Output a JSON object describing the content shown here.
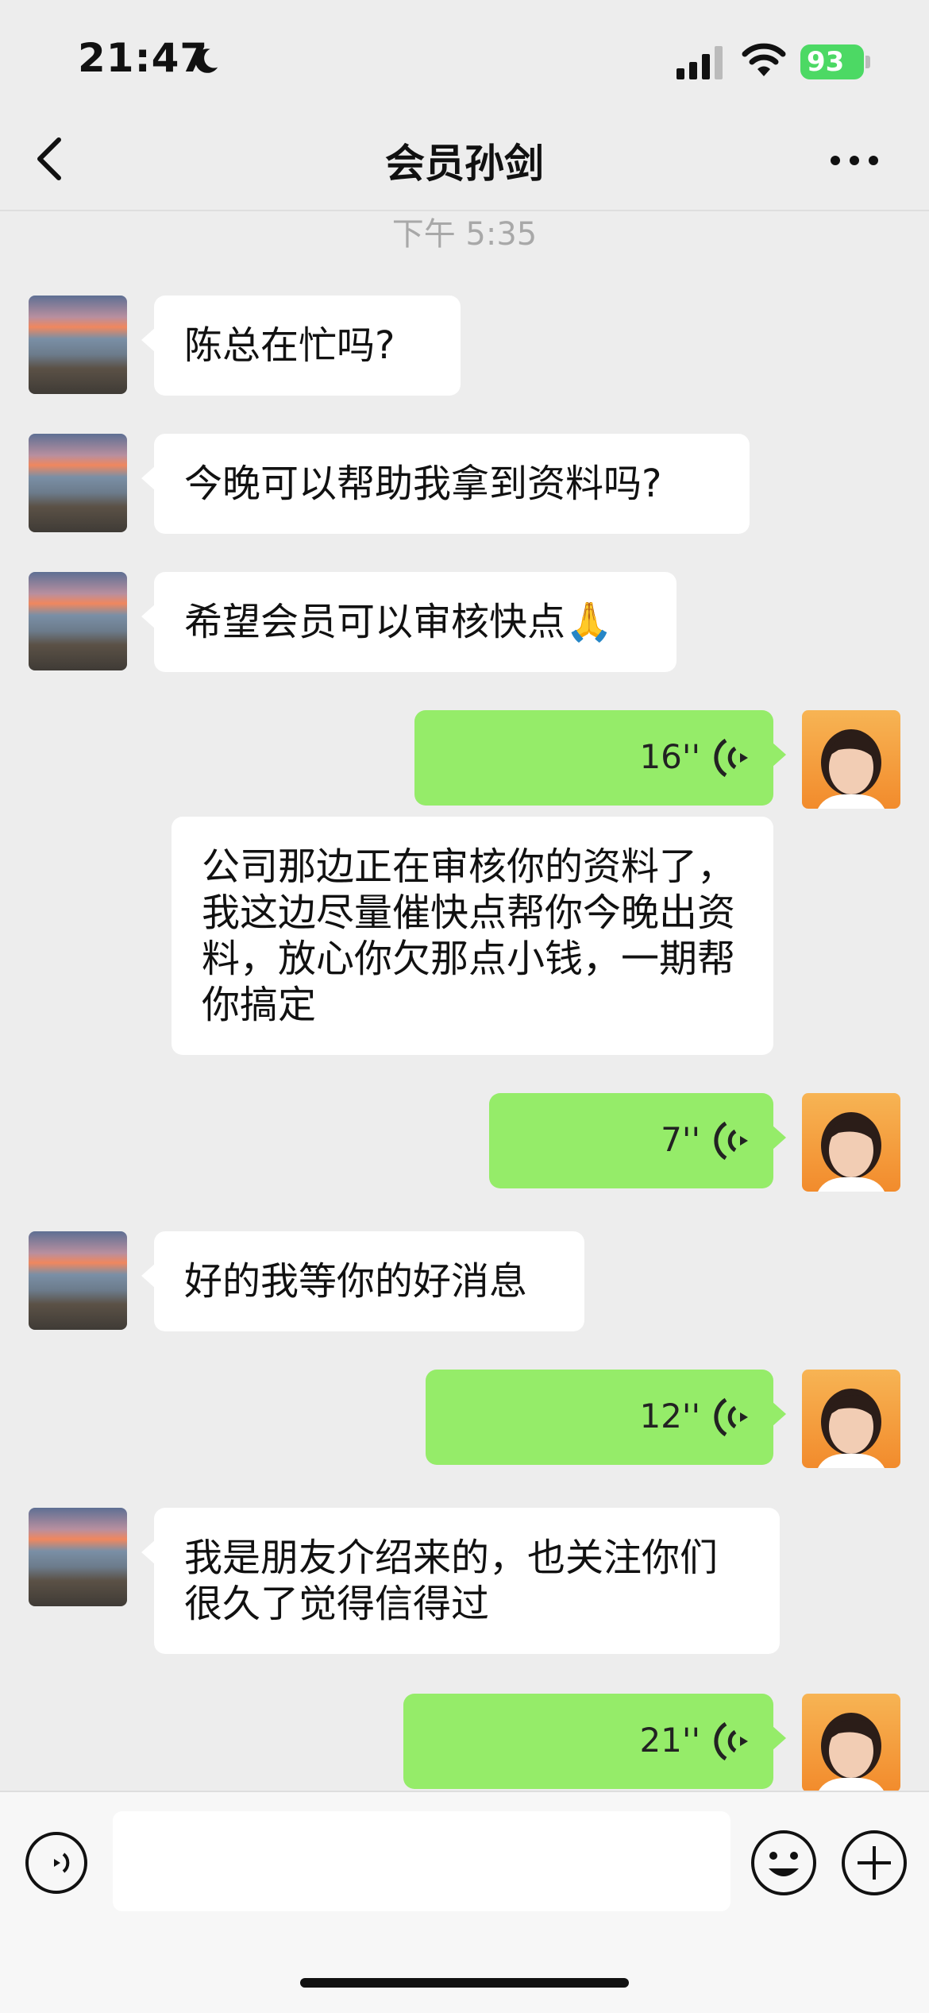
{
  "status_bar": {
    "time": "21:47",
    "battery": "93"
  },
  "nav": {
    "title": "会员孙剑"
  },
  "timestamp": "下午 5:35",
  "messages": [
    {
      "type": "received_text",
      "text": "陈总在忙吗?"
    },
    {
      "type": "received_text",
      "text": "今晚可以帮助我拿到资料吗?"
    },
    {
      "type": "received_text",
      "text": "希望会员可以审核快点🙏"
    },
    {
      "type": "sent_voice",
      "duration": "16''"
    },
    {
      "type": "sent_text",
      "text": "公司那边正在审核你的资料了，我这边尽量催快点帮你今晚出资料，放心你欠那点小钱，一期帮你搞定"
    },
    {
      "type": "sent_voice",
      "duration": "7''"
    },
    {
      "type": "received_text",
      "text": "好的我等你的好消息"
    },
    {
      "type": "sent_voice",
      "duration": "12''"
    },
    {
      "type": "received_text",
      "text": "我是朋友介绍来的，也关注你们很久了觉得信得过"
    },
    {
      "type": "sent_voice",
      "duration": "21''"
    }
  ],
  "input_bar": {
    "placeholder": ""
  },
  "colors": {
    "sent_bubble": "#95ec69",
    "received_bubble": "#ffffff",
    "background": "#ededed",
    "battery": "#4cd964"
  }
}
